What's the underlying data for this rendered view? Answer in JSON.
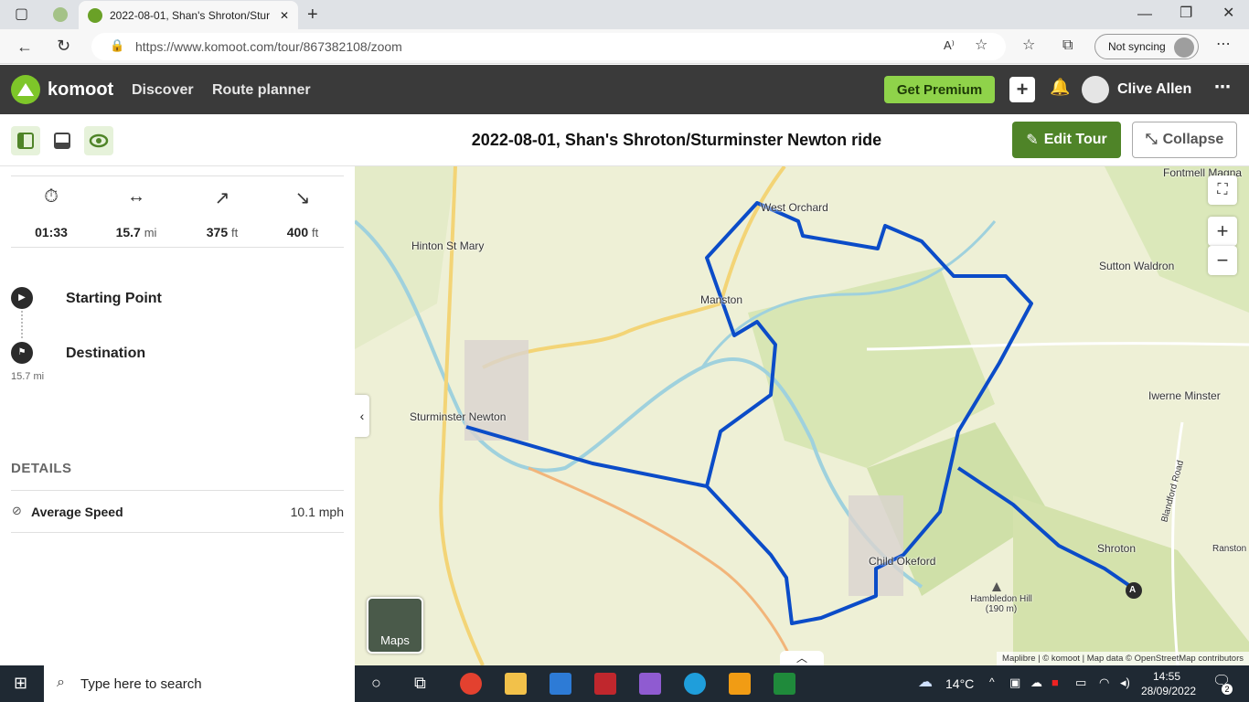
{
  "browser": {
    "tab_title": "2022-08-01, Shan's Shroton/Stur",
    "url": "https://www.komoot.com/tour/867382108/zoom",
    "sync_label": "Not syncing"
  },
  "header": {
    "logo_text": "komoot",
    "nav": [
      "Discover",
      "Route planner"
    ],
    "premium_label": "Get Premium",
    "user_name": "Clive Allen"
  },
  "toolbar": {
    "title": "2022-08-01, Shan's Shroton/Sturminster Newton ride",
    "edit_label": "Edit Tour",
    "collapse_label": "Collapse"
  },
  "stats": [
    {
      "icon": "stopwatch-icon",
      "value": "01:33",
      "unit": ""
    },
    {
      "icon": "distance-icon",
      "value": "15.7",
      "unit": "mi"
    },
    {
      "icon": "uphill-icon",
      "value": "375",
      "unit": "ft"
    },
    {
      "icon": "downhill-icon",
      "value": "400",
      "unit": "ft"
    }
  ],
  "waypoints": {
    "start": "Starting Point",
    "destination": "Destination",
    "destination_distance": "15.7 mi"
  },
  "details": {
    "heading": "DETAILS",
    "avg_speed_label": "Average Speed",
    "avg_speed_value": "10.1 mph"
  },
  "map": {
    "places": [
      "Fontmell Magna",
      "West Orchard",
      "Hinton St Mary",
      "Sutton Waldron",
      "Manston",
      "Iwerne Minster",
      "Sturminster Newton",
      "Blandford Road",
      "Shroton",
      "Child Okeford",
      "Ranston",
      "Hambledon Hill (190 m)"
    ],
    "maps_button": "Maps",
    "start_marker": "A",
    "attribution": "Maplibre | © komoot | Map data © OpenStreetMap contributors",
    "route_color": "#0b4cc8"
  },
  "taskbar": {
    "search_placeholder": "Type here to search",
    "temperature": "14°C",
    "time": "14:55",
    "date": "28/09/2022",
    "notifications": "2"
  }
}
